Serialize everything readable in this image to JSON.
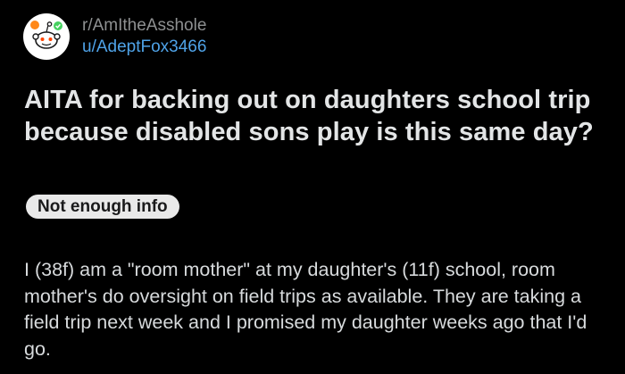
{
  "post": {
    "subreddit": "r/AmItheAsshole",
    "username": "u/AdeptFox3466",
    "title": "AITA for backing out on daughters school trip because disabled sons play is this same day?",
    "flair": "Not enough info",
    "body": "I (38f) am a \"room mother\" at my daughter's (11f) school, room mother's do oversight on field trips as available. They are taking a field trip next week and I promised my daughter weeks ago that I'd go."
  },
  "icons": {
    "avatar": "snoo-avatar-icon"
  },
  "colors": {
    "background": "#000000",
    "username": "#4fa3e8",
    "subreddit": "#8e9091",
    "flair_bg": "#e9e9e9"
  }
}
